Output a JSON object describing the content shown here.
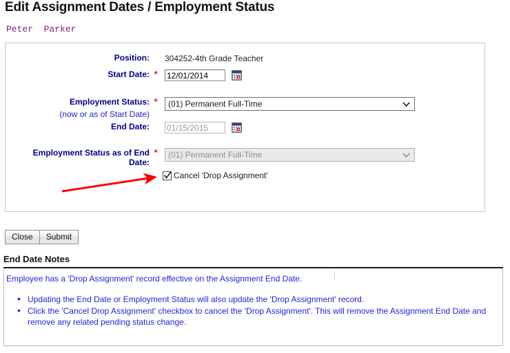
{
  "header": {
    "title": "Edit Assignment Dates / Employment Status",
    "employee_name": "Peter  Parker",
    "name_color": "#7b217b"
  },
  "form": {
    "position": {
      "label": "Position:",
      "value": "304252-4th Grade Teacher",
      "required": false
    },
    "start_date": {
      "label": "Start Date:",
      "required_mark": "*",
      "value": "12/01/2014",
      "calendar_icon": "calendar-icon"
    },
    "employment_status": {
      "label": "Employment Status:",
      "required_mark": "*",
      "sub_label": "(now or as of Start Date)",
      "value": "(01) Permanent Full-Time",
      "dropdown_icon": "chevron-down-icon"
    },
    "end_date": {
      "label": "End Date:",
      "value": "01/15/2015",
      "disabled": true,
      "calendar_icon": "calendar-icon"
    },
    "employment_status_end": {
      "label_line1": "Employment Status as of End",
      "label_line2": "Date:",
      "required_mark": "*",
      "value": "(01) Permanent Full-Time",
      "disabled": true,
      "dropdown_icon": "chevron-down-icon"
    },
    "cancel_drop_assignment": {
      "label": "Cancel 'Drop Assignment'",
      "checked": true
    }
  },
  "buttons": {
    "close": "Close",
    "submit": "Submit"
  },
  "notes": {
    "heading": "End Date Notes",
    "lead": "Employee has a 'Drop Assignment' record effective on the Assignment End Date.",
    "items": [
      "Updating the End Date or Employment Status will also update the 'Drop Assignment' record.",
      "Click the 'Cancel Drop Assignment' checkbox to cancel the 'Drop Assignment'. This will remove the Assignment End Date and remove any related pending status change."
    ],
    "text_color": "#2222dd"
  },
  "annotation": {
    "arrow_color": "#ff0000",
    "points_to": "cancel-drop-assignment-checkbox"
  }
}
